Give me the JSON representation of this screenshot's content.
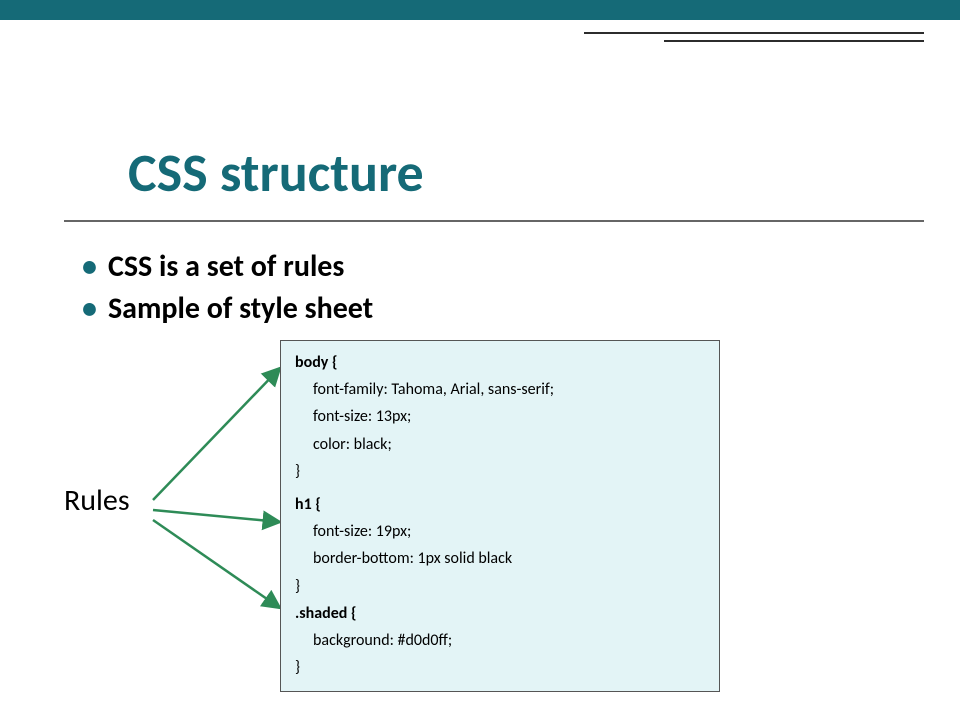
{
  "title": "CSS structure",
  "bullets": [
    "CSS is a set of rules",
    "Sample of style sheet"
  ],
  "rules_label": "Rules",
  "code": {
    "r1_sel": "body {",
    "r1_p1": "font-family: Tahoma, Arial, sans-serif;",
    "r1_p2": "font-size: 13px;",
    "r1_p3": "color: black;",
    "r1_close": "}",
    "r2_sel": "h1 {",
    "r2_p1": "font-size: 19px;",
    "r2_p2": "border-bottom: 1px solid black",
    "r2_close": "}",
    "r3_sel": ".shaded {",
    "r3_p1": "background: #d0d0ff;",
    "r3_close": "}"
  },
  "colors": {
    "accent": "#156a77",
    "code_bg": "#e3f4f6"
  }
}
